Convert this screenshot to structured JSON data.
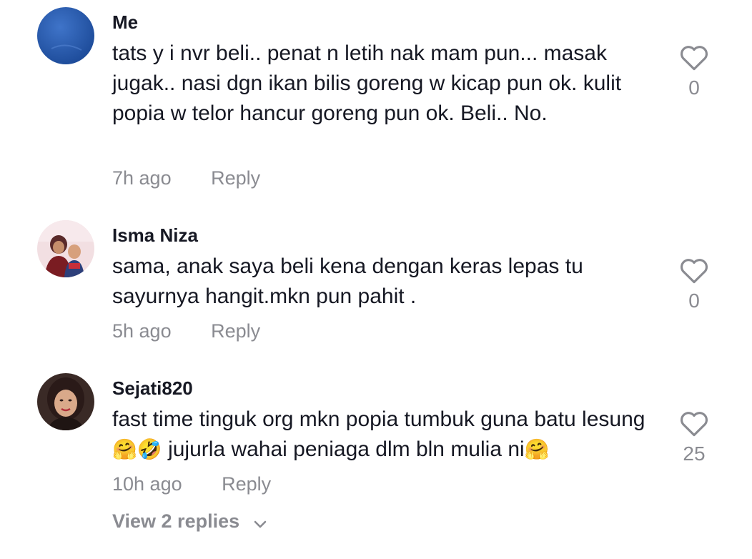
{
  "comments": [
    {
      "username": "Me",
      "text": "tats y i nvr beli.. penat n letih nak mam pun... masak jugak.. nasi dgn ikan bilis goreng w kicap pun ok. kulit popia w telor hancur goreng pun ok. Beli.. No.",
      "time": "7h ago",
      "reply_label": "Reply",
      "likes": "0"
    },
    {
      "username": "Isma Niza",
      "text": "sama, anak saya beli kena dengan keras lepas tu sayurnya hangit.mkn pun pahit .",
      "time": "5h ago",
      "reply_label": "Reply",
      "likes": "0"
    },
    {
      "username": "Sejati820",
      "text_part1": "fast time tinguk org mkn popia tumbuk guna batu lesung ",
      "text_emoji1": "🤗🤣",
      "text_part2": " jujurla wahai peniaga dlm bln mulia ni",
      "text_emoji2": "🤗",
      "time": "10h ago",
      "reply_label": "Reply",
      "likes": "25"
    }
  ],
  "view_replies_label": "View 2 replies",
  "icons": {
    "like": "heart-outline-icon",
    "expand": "chevron-down-icon"
  },
  "colors": {
    "primary_text": "#161823",
    "secondary_text": "#8a8b91"
  }
}
